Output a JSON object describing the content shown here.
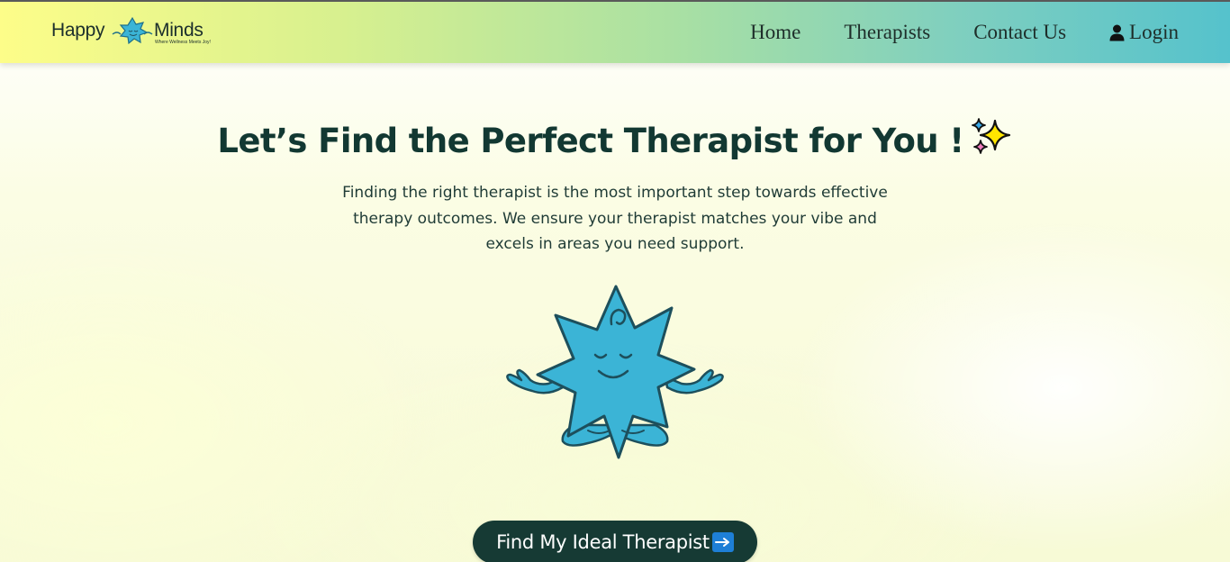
{
  "brand": {
    "name_left": "Happy",
    "name_right": "Minds",
    "tagline": "Where Wellness Meets Joy!",
    "mascot_icon": "star-mascot-icon"
  },
  "nav": {
    "items": [
      {
        "label": "Home"
      },
      {
        "label": "Therapists"
      },
      {
        "label": "Contact Us"
      },
      {
        "label": "Login",
        "icon": "user-icon"
      }
    ]
  },
  "hero": {
    "title_prefix": "Let’s Find the Perfect Therapist for ",
    "title_emphasis": "You",
    "title_suffix": " !",
    "title_icon": "sparkles-icon",
    "description": "Finding the right therapist is the most important step towards effective therapy outcomes. We ensure your therapist matches your vibe and excels in areas you need support.",
    "illustration": "meditating-star-mascot",
    "cta_label": "Find My Ideal Therapist",
    "cta_icon": "right-arrow-icon"
  },
  "colors": {
    "dark_teal": "#163a34",
    "mascot_blue": "#3bb4d6",
    "nav_gradient_start": "#fdfd89",
    "nav_gradient_end": "#55c2cc",
    "arrow_blue": "#1e7fd6"
  }
}
